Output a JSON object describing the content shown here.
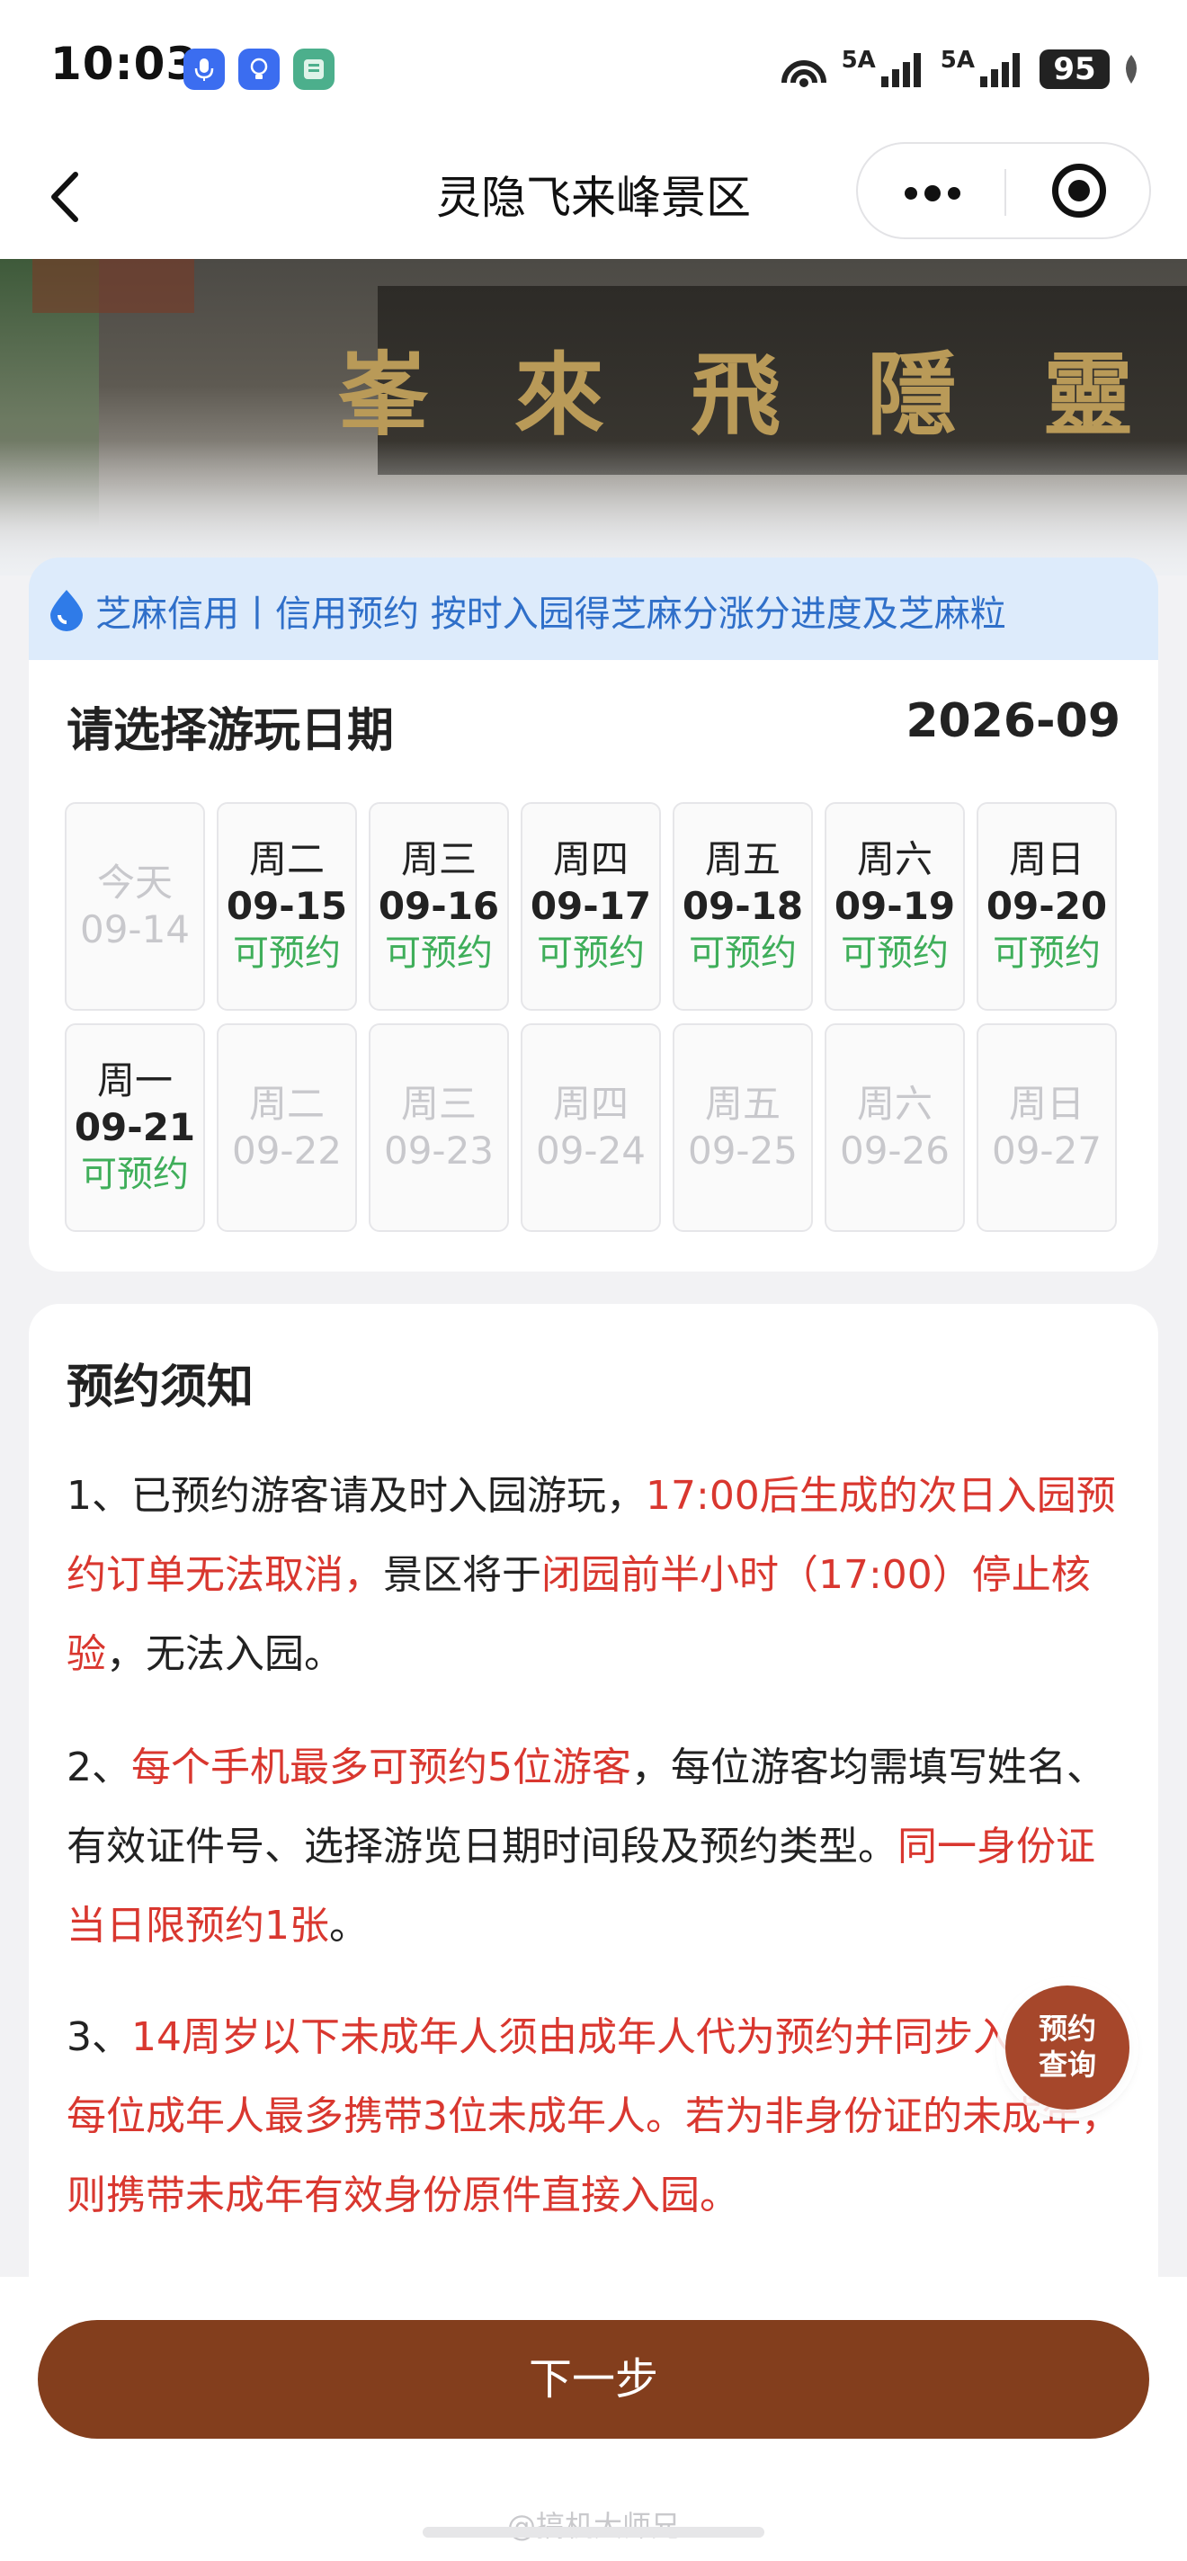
{
  "status_bar": {
    "time": "10:03",
    "icons": [
      "mic-icon",
      "bulb-icon",
      "app-icon",
      "hotspot-icon",
      "signal-icon",
      "signal-icon"
    ],
    "net1": "5A",
    "net2": "5A",
    "battery": "95"
  },
  "header": {
    "title": "灵隐飞来峰景区"
  },
  "banner": {
    "plaque_chars": [
      "峯",
      "來",
      "飛",
      "隱",
      "靈"
    ],
    "colors": {
      "plaque_gold": "#b99a58"
    }
  },
  "credit": {
    "text": "芝麻信用丨信用预约 按时入园得芝麻分涨分进度及芝麻粒"
  },
  "date_select": {
    "title": "请选择游玩日期",
    "month": "2026-09",
    "days": [
      {
        "weekday": "今天",
        "date": "09-14",
        "status": "",
        "enabled": false
      },
      {
        "weekday": "周二",
        "date": "09-15",
        "status": "可预约",
        "enabled": true
      },
      {
        "weekday": "周三",
        "date": "09-16",
        "status": "可预约",
        "enabled": true
      },
      {
        "weekday": "周四",
        "date": "09-17",
        "status": "可预约",
        "enabled": true
      },
      {
        "weekday": "周五",
        "date": "09-18",
        "status": "可预约",
        "enabled": true
      },
      {
        "weekday": "周六",
        "date": "09-19",
        "status": "可预约",
        "enabled": true
      },
      {
        "weekday": "周日",
        "date": "09-20",
        "status": "可预约",
        "enabled": true
      },
      {
        "weekday": "周一",
        "date": "09-21",
        "status": "可预约",
        "enabled": true
      },
      {
        "weekday": "周二",
        "date": "09-22",
        "status": "",
        "enabled": false
      },
      {
        "weekday": "周三",
        "date": "09-23",
        "status": "",
        "enabled": false
      },
      {
        "weekday": "周四",
        "date": "09-24",
        "status": "",
        "enabled": false
      },
      {
        "weekday": "周五",
        "date": "09-25",
        "status": "",
        "enabled": false
      },
      {
        "weekday": "周六",
        "date": "09-26",
        "status": "",
        "enabled": false
      },
      {
        "weekday": "周日",
        "date": "09-27",
        "status": "",
        "enabled": false
      }
    ],
    "colors": {
      "available": "#3fae5a",
      "disabled": "#c8c8cc"
    }
  },
  "notice": {
    "title": "预约须知",
    "items": [
      [
        {
          "text": "1、已预约游客请及时入园游玩，",
          "red": false
        },
        {
          "text": "17:00后生成的次日入园预约订单无法取消，",
          "red": true
        },
        {
          "text": "景区将于",
          "red": false
        },
        {
          "text": "闭园前半小时（17:00）停止核验",
          "red": true
        },
        {
          "text": "，无法入园。",
          "red": false
        }
      ],
      [
        {
          "text": "2、",
          "red": false
        },
        {
          "text": "每个手机最多可预约5位游客",
          "red": true
        },
        {
          "text": "，每位游客均需填写姓名、有效证件号、选择游览日期时间段及预约类型。",
          "red": false
        },
        {
          "text": "同一身份证当日限预约1张",
          "red": true
        },
        {
          "text": "。",
          "red": false
        }
      ],
      [
        {
          "text": "3、",
          "red": false
        },
        {
          "text": "14周岁以下未成年人须由成年人代为预约并同步入园，每位成年人最多携带3位未成年人。若为非身份证的未成年，则携带未成年有效身份原件直接入园。",
          "red": true
        }
      ]
    ],
    "colors": {
      "highlight": "#d9372f"
    }
  },
  "float_button": {
    "label": "预约查询"
  },
  "footer": {
    "next_label": "下一步",
    "watermark": "@搞机大师兄",
    "colors": {
      "button": "#833e1d"
    }
  }
}
